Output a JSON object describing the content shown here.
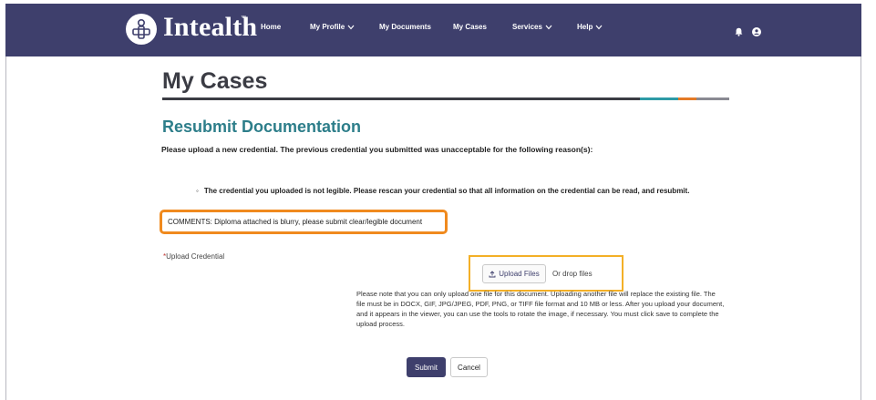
{
  "navbar": {
    "brand": "Intealth",
    "trademark": "™",
    "items": [
      {
        "label": "Home",
        "dropdown": false
      },
      {
        "label": "My Profile",
        "dropdown": true
      },
      {
        "label": "My Documents",
        "dropdown": false
      },
      {
        "label": "My Cases",
        "dropdown": false
      },
      {
        "label": "Services",
        "dropdown": true
      },
      {
        "label": "Help",
        "dropdown": true
      }
    ],
    "icons": [
      "bell-icon",
      "user-avatar-icon"
    ],
    "background_color": "#3e3f6c"
  },
  "page": {
    "title": "My Cases",
    "section_title": "Resubmit Documentation",
    "intro": "Please upload a new credential. The previous credential you submitted was unacceptable for the following reason(s):",
    "reasons": [
      "The credential you uploaded is not legible. Please rescan your credential so that all information on the credential can be read, and resubmit."
    ],
    "comments": "COMMENTS:  Diploma attached is blurry, please submit clear/legible document"
  },
  "upload": {
    "required_marker": "*",
    "label": "Upload Credential",
    "button_label": "Upload Files",
    "drop_text": "Or drop files",
    "note": "Please note that you can only upload one file for this document. Uploading another file will replace the existing file. The file must be in DOCX, GIF, JPG/JPEG, PDF, PNG, or TIFF file format and 10 MB or less. After you upload your document, and it appears in the viewer, you can use the tools to rotate the image, if necessary. You must click save to complete the upload process."
  },
  "actions": {
    "submit_label": "Submit",
    "cancel_label": "Cancel"
  },
  "colors": {
    "accent_teal": "#2d7e8a",
    "highlight_orange": "#f08a1e",
    "highlight_yellow": "#f3b027"
  }
}
